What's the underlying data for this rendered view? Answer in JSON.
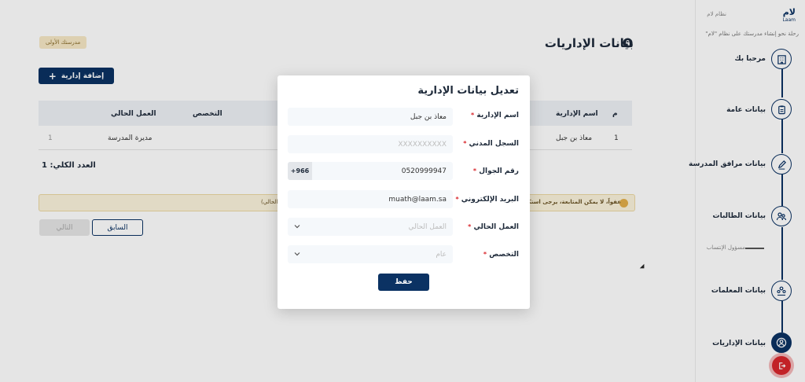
{
  "brand": {
    "logo": "لام",
    "logo_en": "Laam",
    "caption": "نظام لام",
    "tagline": "رحلة نحو إنشاء مدرستك على نظام \"لام\""
  },
  "steps": [
    {
      "label": "مرحبا بك",
      "icon": "building-icon"
    },
    {
      "label": "بيانات عامة",
      "icon": "clipboard-icon"
    },
    {
      "label": "بيانات مرافق المدرسة",
      "icon": "pencil-icon"
    },
    {
      "label": "بيانات الطالبات",
      "icon": "students-icon",
      "sub": "مسؤول الإنتساب"
    },
    {
      "label": "بيانات المعلمات",
      "icon": "teachers-icon"
    },
    {
      "label": "بيانات الإداريات",
      "icon": "admin-icon"
    }
  ],
  "page": {
    "title": "بيانات الإداريات",
    "school_badge": "مدرستك الأولى",
    "add_button": "إضافة إدارية",
    "table": {
      "headers": [
        "م",
        "اسم الإدارية",
        "التخصص",
        "العمل الحالي"
      ],
      "rows": [
        {
          "index": "1",
          "name": "معاذ بن جبل",
          "specialty": "",
          "job": "مديرة المدرسة",
          "count": "1"
        }
      ]
    },
    "total": "العدد الكلي: 1",
    "warning": "عفواً، لا يمكن المتابعة، يرجى استكمال البيانات المطلوبة",
    "warning_tail": "(الحالي)",
    "prev_button": "السابق",
    "next_button": "التالي"
  },
  "modal": {
    "title": "تعديل بيانات الإدارية",
    "fields": {
      "name": {
        "label": "اسم الإدارية",
        "value": "معاذ بن جبل"
      },
      "civil_id": {
        "label": "السجل المدني",
        "placeholder": "XXXXXXXXXX"
      },
      "phone": {
        "label": "رقم الجوال",
        "value": "0520999947",
        "prefix": "+966"
      },
      "email": {
        "label": "البريد الإلكتروني",
        "value": "muath@laam.sa"
      },
      "job": {
        "label": "العمل الحالي",
        "placeholder": "العمل الحالي"
      },
      "specialty": {
        "label": "التخصص",
        "placeholder": "عام"
      }
    },
    "save_button": "حفظ"
  },
  "colors": {
    "primary": "#0b3263",
    "danger": "#d9262c",
    "warning_bg": "#fbf3dc"
  }
}
